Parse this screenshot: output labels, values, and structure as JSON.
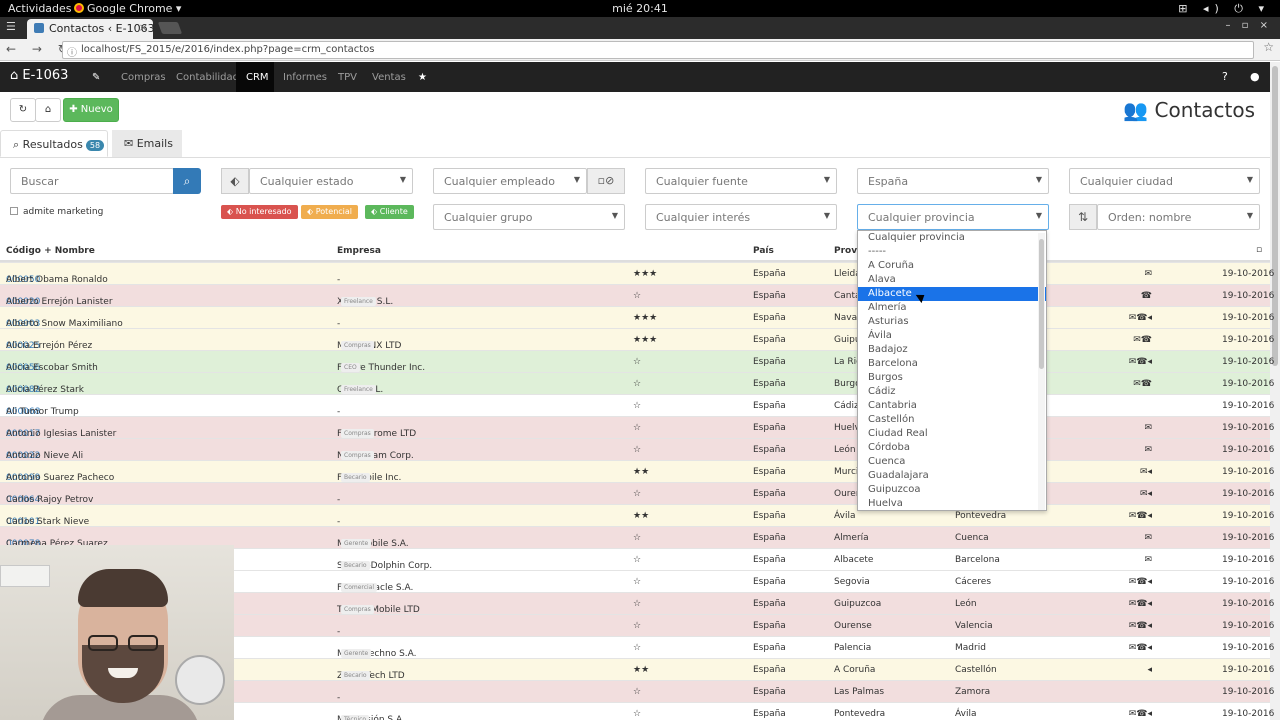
{
  "os": {
    "activities": "Actividades",
    "app": "Google Chrome ▾",
    "clock": "mié 20:41",
    "tray": "⊞ ◂) ⏻ ▾"
  },
  "browser": {
    "tab_title": "Contactos ‹ E-1063",
    "url": "localhost/FS_2015/e/2016/index.php?page=crm_contactos",
    "nav": "← → ↻"
  },
  "topnav": {
    "brand": "E-1063",
    "items": [
      "Compras",
      "Contabilidad",
      "CRM",
      "Informes",
      "TPV",
      "Ventas"
    ]
  },
  "toolbar": {
    "new_label": "Nuevo",
    "page_title": "Contactos"
  },
  "tabs": {
    "results_label": "Resultados",
    "results_count": "58",
    "emails_label": "Emails"
  },
  "filters": {
    "search_placeholder": "Buscar",
    "estado": "Cualquier estado",
    "empleado": "Cualquier empleado",
    "fuente": "Cualquier fuente",
    "pais": "España",
    "ciudad": "Cualquier ciudad",
    "grupo": "Cualquier grupo",
    "interes": "Cualquier interés",
    "provincia": "Cualquier provincia",
    "orden": "Orden: nombre",
    "marketing": "admite marketing",
    "no_interesado": "No interesado",
    "potencial": "Potencial",
    "cliente": "Cliente"
  },
  "table": {
    "headers": {
      "codigo": "Código + Nombre",
      "empresa": "Empresa",
      "pais": "País",
      "provincia": "Provi"
    },
    "rows": [
      {
        "code": "000050",
        "name": "Albert Obama Ronaldo",
        "empresa": "-",
        "tag": "",
        "stars": "★★★",
        "pais": "España",
        "prov": "Lleida",
        "ciudad": "",
        "icons": "✉",
        "fecha": "19-10-2016",
        "cls": "r-warn"
      },
      {
        "code": "000020",
        "name": "Alberto Errejón Lanister",
        "empresa": "X Phone S.L.",
        "tag": "Freelance",
        "stars": "☆",
        "pais": "España",
        "prov": "Canta",
        "ciudad": "",
        "icons": "☎",
        "fecha": "19-10-2016",
        "cls": "r-danger"
      },
      {
        "code": "000003",
        "name": "Alberto Snow Maximiliano",
        "empresa": "-",
        "tag": "",
        "stars": "★★★",
        "pais": "España",
        "prov": "Navar",
        "ciudad": "",
        "icons": "✉☎◂",
        "fecha": "19-10-2016",
        "cls": "r-warn"
      },
      {
        "code": "000025",
        "name": "Alicia Errejón Pérez",
        "empresa": "MiracleNX LTD",
        "tag": "Compras",
        "stars": "★★★",
        "pais": "España",
        "prov": "Guipu",
        "ciudad": "",
        "icons": "✉☎",
        "fecha": "19-10-2016",
        "cls": "r-warn"
      },
      {
        "code": "000056",
        "name": "Alicia Escobar Smith",
        "empresa": "Future Thunder Inc.",
        "tag": "CEO",
        "stars": "☆",
        "pais": "España",
        "prov": "La Rio",
        "ciudad": "",
        "icons": "✉☎◂",
        "fecha": "19-10-2016",
        "cls": "r-success"
      },
      {
        "code": "000082",
        "name": "Alicia Pérez Stark",
        "empresa": "Q*Cat S.L.",
        "tag": "Freelance",
        "stars": "☆",
        "pais": "España",
        "prov": "Burgo",
        "ciudad": "",
        "icons": "✉☎",
        "fecha": "19-10-2016",
        "cls": "r-success"
      },
      {
        "code": "000068",
        "name": "Ali Tumor Trump",
        "empresa": "-",
        "tag": "",
        "stars": "☆",
        "pais": "España",
        "prov": "Cádiz",
        "ciudad": "",
        "icons": "",
        "fecha": "19-10-2016",
        "cls": "r-plain"
      },
      {
        "code": "000017",
        "name": "Antonio Iglesias Lanister",
        "empresa": "Fake_Chrome LTD",
        "tag": "Compras",
        "stars": "☆",
        "pais": "España",
        "prov": "Huelv",
        "ciudad": "",
        "icons": "✉",
        "fecha": "19-10-2016",
        "cls": "r-danger"
      },
      {
        "code": "000022",
        "name": "Antonio Nieve Ali",
        "empresa": "Neo/Steam Corp.",
        "tag": "Compras",
        "stars": "☆",
        "pais": "España",
        "prov": "León",
        "ciudad": "",
        "icons": "✉",
        "fecha": "19-10-2016",
        "cls": "r-danger"
      },
      {
        "code": "000099",
        "name": "Antonio Suarez Pacheco",
        "empresa": "FX*Mobile Inc.",
        "tag": "Becario",
        "stars": "★★",
        "pais": "España",
        "prov": "Murci",
        "ciudad": "",
        "icons": "✉◂",
        "fecha": "19-10-2016",
        "cls": "r-warn"
      },
      {
        "code": "000064",
        "name": "Carlos Rajoy Petrov",
        "empresa": "-",
        "tag": "",
        "stars": "☆",
        "pais": "España",
        "prov": "Ourer",
        "ciudad": "",
        "icons": "✉◂",
        "fecha": "19-10-2016",
        "cls": "r-danger"
      },
      {
        "code": "000101",
        "name": "Carlos Stark Nieve",
        "empresa": "-",
        "tag": "",
        "stars": "★★",
        "pais": "España",
        "prov": "Ávila",
        "ciudad": "Pontevedra",
        "icons": "✉☎◂",
        "fecha": "19-10-2016",
        "cls": "r-warn"
      },
      {
        "code": "000078",
        "name": "Carmena Pérez Suarez",
        "empresa": "Max-Mobile S.A.",
        "tag": "Gerente",
        "stars": "☆",
        "pais": "España",
        "prov": "Almería",
        "ciudad": "Cuenca",
        "icons": "✉",
        "fecha": "19-10-2016",
        "cls": "r-danger"
      },
      {
        "code": "",
        "name": "",
        "empresa": "Smoke-Dolphin Corp.",
        "tag": "Becario",
        "stars": "☆",
        "pais": "España",
        "prov": "Albacete",
        "ciudad": "Barcelona",
        "icons": "✉",
        "fecha": "19-10-2016",
        "cls": "r-plain"
      },
      {
        "code": "",
        "name": "",
        "empresa": "Fake-Miracle S.A.",
        "tag": "Comercial",
        "stars": "☆",
        "pais": "España",
        "prov": "Segovia",
        "ciudad": "Cáceres",
        "icons": "✉☎◂",
        "fecha": "19-10-2016",
        "cls": "r-plain"
      },
      {
        "code": "",
        "name": "",
        "empresa": "Techno Mobile LTD",
        "tag": "Compras",
        "stars": "☆",
        "pais": "España",
        "prov": "Guipuzcoa",
        "ciudad": "León",
        "icons": "✉☎◂",
        "fecha": "19-10-2016",
        "cls": "r-danger"
      },
      {
        "code": "",
        "name": "",
        "empresa": "-",
        "tag": "",
        "stars": "☆",
        "pais": "España",
        "prov": "Ourense",
        "ciudad": "Valencia",
        "icons": "✉☎◂",
        "fecha": "19-10-2016",
        "cls": "r-danger"
      },
      {
        "code": "",
        "name": "",
        "empresa": "Motor-Techno S.A.",
        "tag": "Gerente",
        "stars": "☆",
        "pais": "España",
        "prov": "Palencia",
        "ciudad": "Madrid",
        "icons": "✉☎◂",
        "fecha": "19-10-2016",
        "cls": "r-plain"
      },
      {
        "code": "",
        "name": "",
        "empresa": "Zelda/Tech LTD",
        "tag": "Becario",
        "stars": "★★",
        "pais": "España",
        "prov": "A Coruña",
        "ciudad": "Castellón",
        "icons": "◂",
        "fecha": "19-10-2016",
        "cls": "r-warn"
      },
      {
        "code": "",
        "name": "",
        "empresa": "-",
        "tag": "",
        "stars": "☆",
        "pais": "España",
        "prov": "Las Palmas",
        "ciudad": "Zamora",
        "icons": "",
        "fecha": "19-10-2016",
        "cls": "r-danger"
      },
      {
        "code": "",
        "name": "",
        "empresa": "MaxPasión S.A.",
        "tag": "Técnico",
        "stars": "☆",
        "pais": "España",
        "prov": "Pontevedra",
        "ciudad": "Ávila",
        "icons": "✉☎◂",
        "fecha": "19-10-2016",
        "cls": "r-plain"
      }
    ]
  },
  "provincia_dropdown": {
    "options": [
      "Cualquier provincia",
      "-----",
      "A Coruña",
      "Alava",
      "Albacete",
      "Almería",
      "Asturias",
      "Ávila",
      "Badajoz",
      "Barcelona",
      "Burgos",
      "Cádiz",
      "Cantabria",
      "Castellón",
      "Ciudad Real",
      "Córdoba",
      "Cuenca",
      "Guadalajara",
      "Guipuzcoa",
      "Huelva"
    ],
    "selected": "Albacete"
  }
}
